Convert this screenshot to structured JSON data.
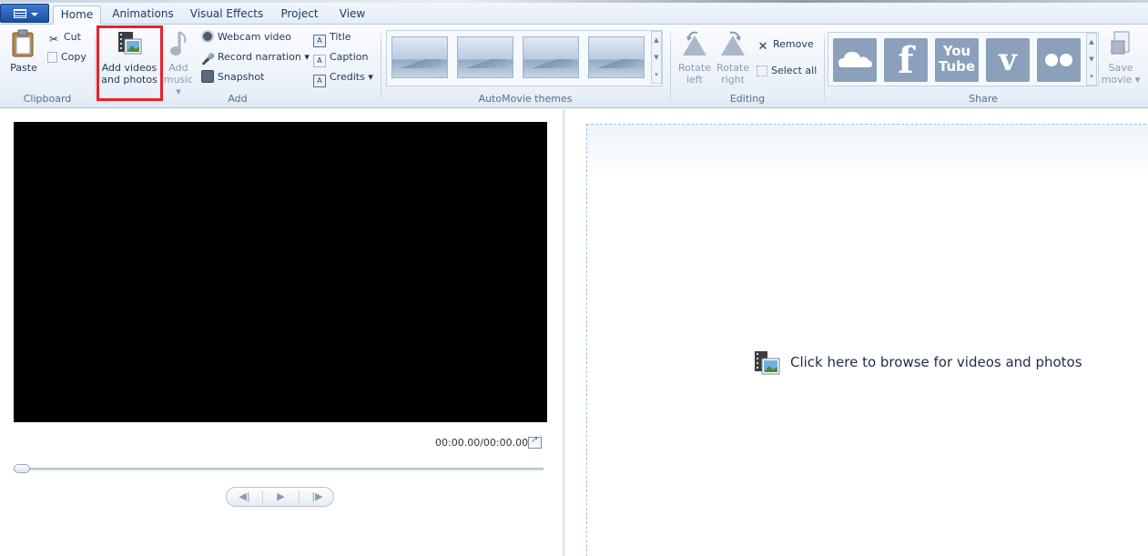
{
  "ribbon": {
    "tabs": [
      "Home",
      "Animations",
      "Visual Effects",
      "Project",
      "View"
    ],
    "clipboard": {
      "paste": "Paste",
      "cut": "Cut",
      "copy": "Copy",
      "label": "Clipboard"
    },
    "add": {
      "add_videos_line1": "Add videos",
      "add_videos_line2": "and photos",
      "add_music_line1": "Add",
      "add_music_line2": "music",
      "webcam": "Webcam video",
      "narration": "Record narration",
      "snapshot": "Snapshot",
      "title": "Title",
      "caption": "Caption",
      "credits": "Credits",
      "label": "Add"
    },
    "themes": {
      "label": "AutoMovie themes"
    },
    "editing": {
      "rotate_left_1": "Rotate",
      "rotate_left_2": "left",
      "rotate_right_1": "Rotate",
      "rotate_right_2": "right",
      "remove": "Remove",
      "select_all": "Select all",
      "label": "Editing"
    },
    "share": {
      "youtube_1": "You",
      "youtube_2": "Tube",
      "save_1": "Save",
      "save_2": "movie",
      "label": "Share"
    }
  },
  "player": {
    "timecode": "00:00.00/00:00.00"
  },
  "storyboard": {
    "browse_text": "Click here to browse for videos and photos"
  },
  "colors": {
    "accent": "#1e395b",
    "highlight": "#e8202b",
    "share_icon": "#8aa0bb"
  }
}
